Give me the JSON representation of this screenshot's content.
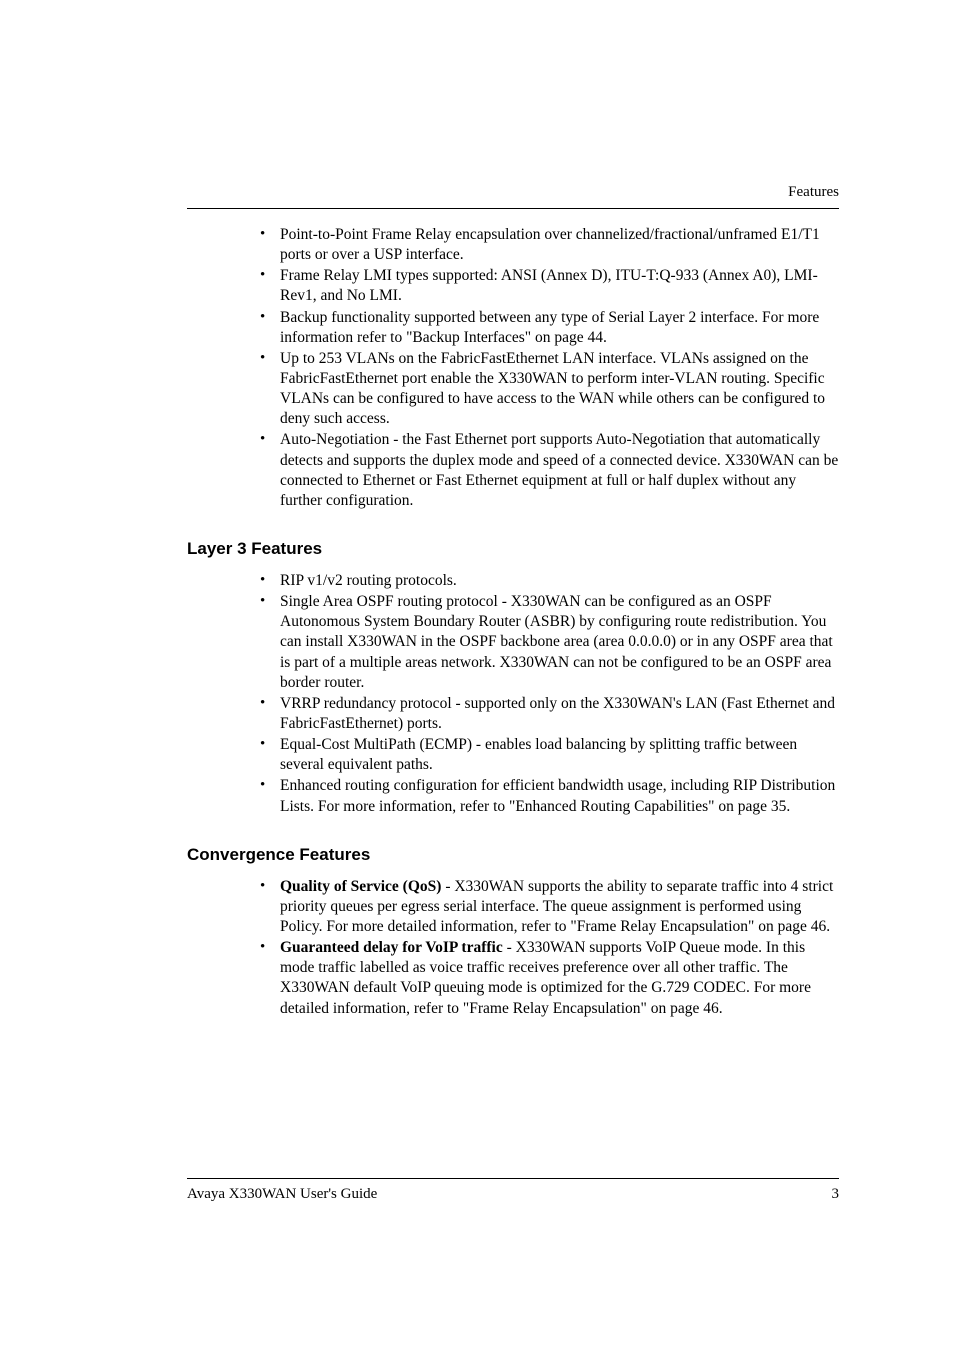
{
  "header": {
    "runningTitle": "Features"
  },
  "section1": {
    "bullets": [
      "Point-to-Point Frame Relay encapsulation over channelized/fractional/unframed E1/T1 ports or over a USP interface.",
      "Frame Relay LMI types supported: ANSI (Annex D), ITU-T:Q-933 (Annex A0), LMI-Rev1, and No LMI.",
      "Backup functionality supported between any type of Serial Layer 2 interface. For more information refer to \"Backup Interfaces\" on page 44.",
      "Up to 253 VLANs on the FabricFastEthernet LAN interface. VLANs assigned on the FabricFastEthernet port enable the X330WAN to perform inter-VLAN routing. Specific VLANs can be configured to have access to the WAN while others can be configured to deny such access.",
      "Auto-Negotiation - the Fast Ethernet port supports Auto-Negotiation that automatically detects and supports the duplex mode and speed of a connected device. X330WAN can be connected to Ethernet or Fast Ethernet equipment at full or half duplex without any further configuration."
    ]
  },
  "section2": {
    "heading": "Layer 3 Features",
    "bullets": [
      "RIP v1/v2 routing protocols.",
      "Single Area OSPF routing protocol - X330WAN can be configured as an OSPF Autonomous System Boundary Router (ASBR) by configuring route redistribution. You can install X330WAN in the OSPF backbone area (area 0.0.0.0) or in any OSPF area that is part of a multiple areas network. X330WAN can not be configured to be an OSPF area border router.",
      "VRRP redundancy protocol - supported only on the X330WAN's LAN (Fast Ethernet and FabricFastEthernet) ports.",
      "Equal-Cost MultiPath (ECMP) - enables load balancing by splitting traffic between several equivalent paths.",
      "Enhanced routing configuration for efficient bandwidth usage, including RIP Distribution Lists. For more information, refer to \"Enhanced Routing Capabilities\" on page 35."
    ]
  },
  "section3": {
    "heading": "Convergence Features",
    "bullets": [
      {
        "bold": "Quality of Service (QoS)",
        "rest": " - X330WAN supports the ability to separate traffic into 4 strict priority queues per egress serial interface. The queue assignment is performed using Policy. For more detailed information, refer to \"Frame Relay Encapsulation\" on page 46."
      },
      {
        "bold": "Guaranteed delay for VoIP traffic",
        "rest": " - X330WAN supports VoIP Queue mode. In this mode traffic labelled as voice traffic receives preference over all other traffic. The X330WAN default VoIP queuing mode is optimized for the G.729 CODEC. For more detailed information, refer to \"Frame Relay Encapsulation\" on page 46."
      }
    ]
  },
  "footer": {
    "text": "Avaya X330WAN User's Guide",
    "page": "3"
  }
}
